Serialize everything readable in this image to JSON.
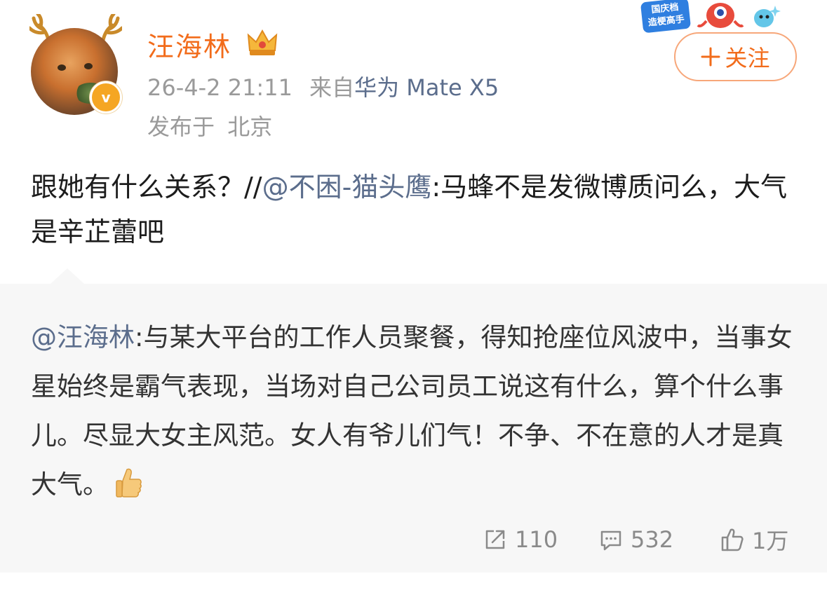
{
  "header": {
    "username": "汪海林",
    "timestamp": "26-4-2 21:11",
    "source_prefix": "来自",
    "source_device": "华为 Mate X5",
    "location_label": "发布于",
    "location": "北京",
    "verified_badge": "v"
  },
  "promo": {
    "badge_line1": "国庆档",
    "badge_line2": "造梗高手"
  },
  "follow_button": {
    "label": "关注",
    "icon": "plus-icon"
  },
  "post": {
    "text_before": "跟她有什么关系？//",
    "mention": "@不困-猫头鹰",
    "text_after": ":马蜂不是发微博质问么，大气是辛芷蕾吧"
  },
  "quote": {
    "mention": "@汪海林",
    "text": ":与某大平台的工作人员聚餐，得知抢座位风波中，当事女星始终是霸气表现，当场对自己公司员工说这有什么，算个什么事儿。尽显大女主风范。女人有爷儿们气！不争、不在意的人才是真大气。",
    "emoji": "thumbs-up-icon",
    "repost_count": "110",
    "comment_count": "532",
    "like_count": "1万"
  },
  "colors": {
    "username": "#f26c1b",
    "link": "#5b6d8c",
    "meta": "#9a9a9a",
    "quote_bg": "#f7f7f7",
    "follow_border": "#f7a77a"
  }
}
